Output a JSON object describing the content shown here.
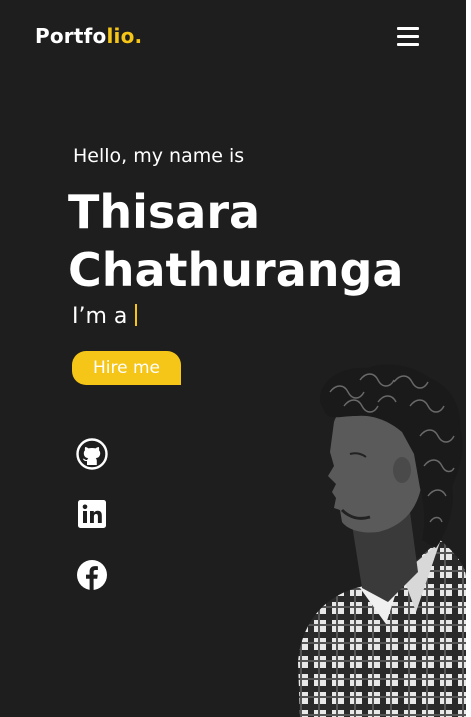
{
  "header": {
    "logo_main": "Portfo",
    "logo_accent": "lio.",
    "menu_icon": "hamburger-menu-icon"
  },
  "hero": {
    "greeting": "Hello, my name is",
    "name_line1": "Thisara",
    "name_line2": "Chathuranga",
    "role_prefix": "I’m a",
    "hire_button": "Hire me"
  },
  "social": [
    {
      "icon": "github-icon"
    },
    {
      "icon": "linkedin-icon"
    },
    {
      "icon": "facebook-icon"
    }
  ],
  "colors": {
    "background": "#1e1e1e",
    "accent": "#f5c518",
    "text": "#ffffff"
  }
}
